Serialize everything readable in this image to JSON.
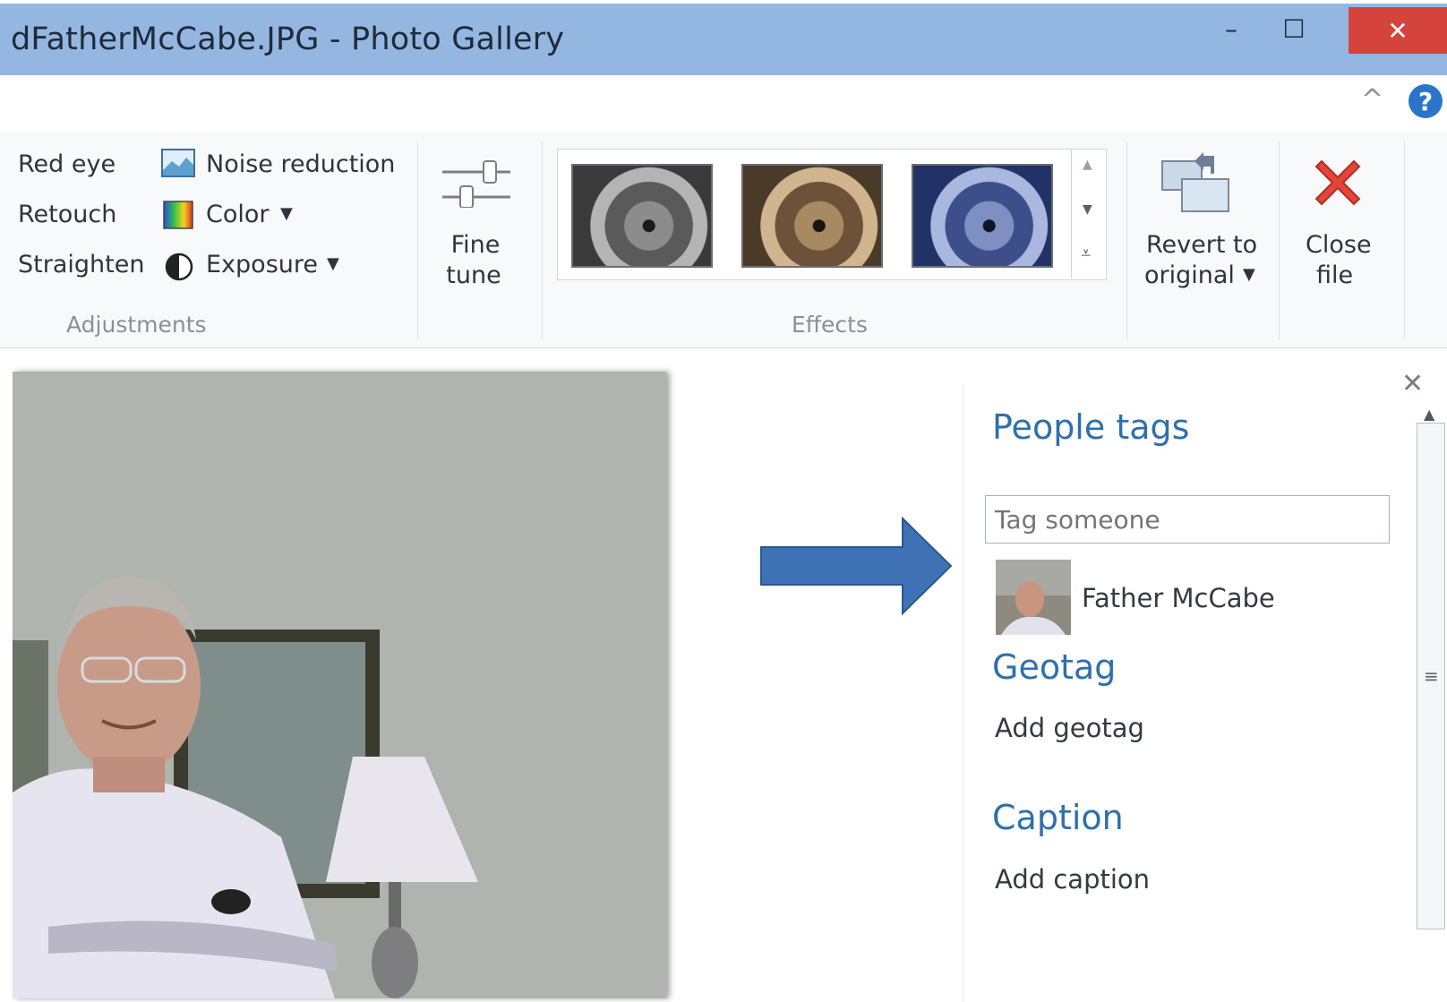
{
  "window": {
    "title": "dFatherMcCabe.JPG - Photo Gallery",
    "minimize_glyph": "–",
    "maximize_glyph": "☐",
    "close_glyph": "✕"
  },
  "ribbon": {
    "collapse_glyph": "^",
    "help_glyph": "?",
    "adjustments": {
      "red_eye": "Red eye",
      "retouch": "Retouch",
      "straighten": "Straighten",
      "noise_reduction": "Noise reduction",
      "color": "Color",
      "exposure": "Exposure",
      "group_label": "Adjustments"
    },
    "fine_tune": {
      "line1": "Fine",
      "line2": "tune"
    },
    "effects": {
      "group_label": "Effects",
      "thumbnails": [
        "grayscale",
        "sepia",
        "cyan-tone"
      ]
    },
    "revert": {
      "line1": "Revert to",
      "line2": "original"
    },
    "close_file": {
      "line1": "Close",
      "line2": "file"
    }
  },
  "info_panel": {
    "close_glyph": "✕",
    "people_tags_heading": "People tags",
    "tag_placeholder": "Tag someone",
    "tagged_person": "Father McCabe",
    "geotag_heading": "Geotag",
    "geotag_action": "Add geotag",
    "caption_heading": "Caption",
    "caption_action": "Add caption"
  },
  "colors": {
    "titlebar": "#93b7e0",
    "close_button": "#d4433c",
    "heading_blue": "#2f6fae",
    "arrow_fill": "#3f72b5"
  },
  "icons": [
    "noise-reduction-icon",
    "color-icon",
    "exposure-icon",
    "fine-tune-icon",
    "revert-icon",
    "close-file-icon",
    "arrow-annotation"
  ]
}
